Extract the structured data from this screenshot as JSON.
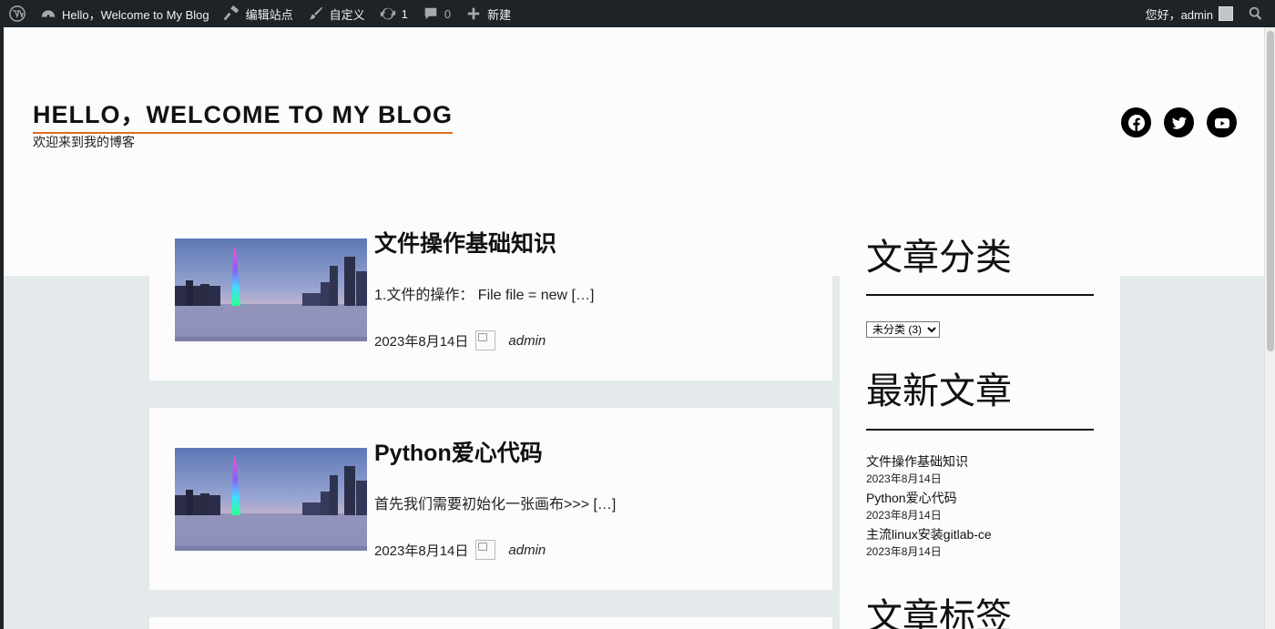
{
  "admin_bar": {
    "site_name": "Hello，Welcome to My Blog",
    "edit_site": "编辑站点",
    "customize": "自定义",
    "updates_count": "1",
    "comments_count": "0",
    "new_label": "新建",
    "greeting": "您好，admin"
  },
  "header": {
    "site_title": "HELLO，WELCOME TO MY BLOG",
    "tagline": "欢迎来到我的博客",
    "social_icons": [
      "wordpress-icon",
      "facebook-icon",
      "twitter-icon",
      "youtube-icon"
    ],
    "title_underline_color": "#e06b1f"
  },
  "posts": [
    {
      "title": "文件操作基础知识",
      "excerpt": "1.文件的操作：  File file = new […]",
      "date": "2023年8月14日",
      "author": "admin"
    },
    {
      "title": "Python爱心代码",
      "excerpt": "首先我们需要初始化一张画布>>> […]",
      "date": "2023年8月14日",
      "author": "admin"
    }
  ],
  "sidebar": {
    "categories_title": "文章分类",
    "category_select_value": "未分类  (3)",
    "recent_title": "最新文章",
    "recent_posts": [
      {
        "title": "文件操作基础知识",
        "date": "2023年8月14日"
      },
      {
        "title": "Python爱心代码",
        "date": "2023年8月14日"
      },
      {
        "title": "主流linux安装gitlab-ce",
        "date": "2023年8月14日"
      }
    ],
    "tags_title": "文章标签"
  }
}
